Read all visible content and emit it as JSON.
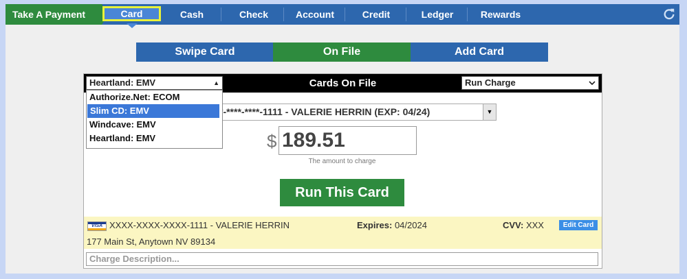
{
  "nav": {
    "title": "Take A Payment",
    "tabs": [
      "Card",
      "Cash",
      "Check",
      "Account",
      "Credit",
      "Ledger",
      "Rewards"
    ],
    "active_tab": "Card",
    "refresh_icon": "refresh-icon"
  },
  "subtabs": {
    "items": [
      "Swipe Card",
      "On File",
      "Add Card"
    ],
    "active": "On File"
  },
  "panel": {
    "title": "Cards On File",
    "processor_select": "Heartland: EMV",
    "processor_options": [
      "Authorize.Net: ECOM",
      "Slim CD: EMV",
      "Windcave: EMV",
      "Heartland: EMV"
    ],
    "processor_highlighted": "Slim CD: EMV",
    "action_select": "Run Charge",
    "card_select": "*-****-****-1111 - VALERIE HERRIN (EXP: 04/24)",
    "currency_symbol": "$",
    "amount": "189.51",
    "amount_hint": "The amount to charge",
    "run_button": "Run This Card"
  },
  "card": {
    "brand": "VISA",
    "number": "XXXX-XXXX-XXXX-1111 - VALERIE HERRIN",
    "expires_label": "Expires:",
    "expires_value": "04/2024",
    "cvv_label": "CVV:",
    "cvv_value": "XXX",
    "edit_button": "Edit Card",
    "address": "177 Main St, Anytown NV 89134"
  },
  "description": {
    "placeholder": "Charge Description..."
  },
  "colors": {
    "nav_blue": "#2d67ae",
    "green": "#2e8b3e",
    "highlight_yellow": "#e8f23a",
    "card_info_bg": "#fbf6c2"
  }
}
